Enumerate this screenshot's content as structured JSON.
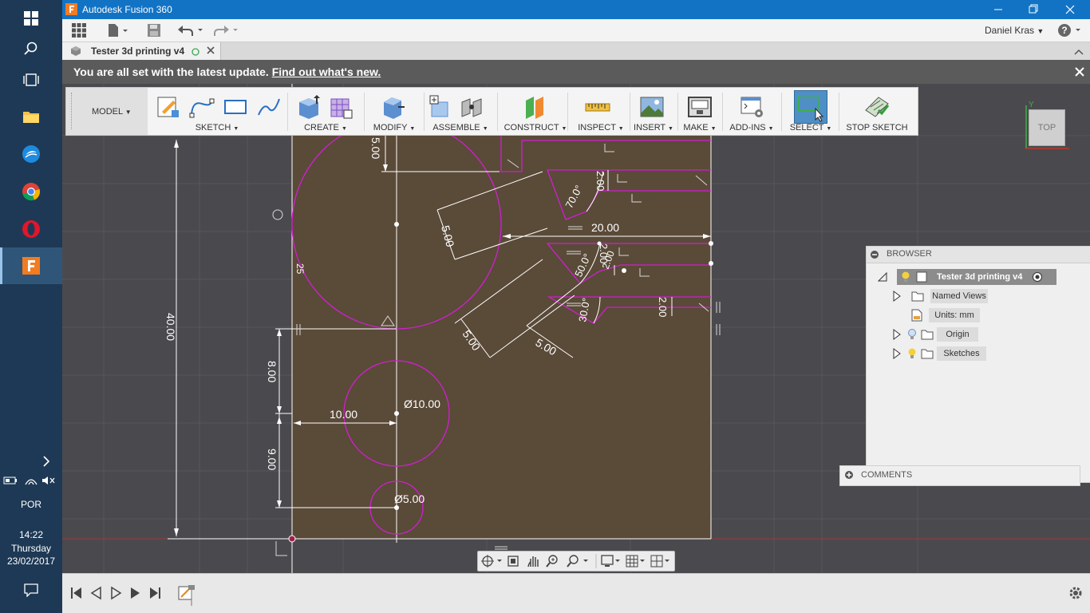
{
  "taskbar": {
    "language": "POR",
    "time": "14:22",
    "day": "Thursday",
    "date": "23/02/2017"
  },
  "window": {
    "title": "Autodesk Fusion 360",
    "user": "Daniel Kras",
    "help": "?"
  },
  "tab": {
    "name": "Tester 3d printing v4"
  },
  "banner": {
    "text": "You are all set with the latest update.",
    "link": "Find out what's new."
  },
  "ribbon": {
    "workspace": "MODEL",
    "groups": [
      "SKETCH",
      "CREATE",
      "MODIFY",
      "ASSEMBLE",
      "CONSTRUCT",
      "INSPECT",
      "INSERT",
      "MAKE",
      "ADD-INS",
      "SELECT",
      "STOP SKETCH"
    ]
  },
  "viewcube": {
    "face": "TOP",
    "axis_y": "Y"
  },
  "dimensions": {
    "d20": "20.00",
    "d40": "40.00",
    "d8": "8.00",
    "d9": "9.00",
    "d10": "10.00",
    "dia10": "Ø10.00",
    "dia5": "Ø5.00",
    "d5a": "5.00",
    "d5b": "5.00",
    "d5c": "5.00",
    "d5top": "5.00",
    "d25": "25",
    "a70": "70.0°",
    "a50": "50.0°",
    "a30": "30.0°",
    "d2": "2.00",
    "d2b": "2.00",
    "d2c": "2.00",
    "d2d": "2.00"
  },
  "browser": {
    "title": "BROWSER",
    "root": "Tester 3d printing v4",
    "items": [
      "Named Views",
      "Units: mm",
      "Origin",
      "Sketches"
    ]
  },
  "comments": {
    "title": "COMMENTS"
  },
  "colors": {
    "title_bar": "#1273c5",
    "taskbar": "#1e3955",
    "sketch_line": "#d11fd1",
    "dimension": "#ffffff",
    "profile_fill": "#5a4a38"
  }
}
